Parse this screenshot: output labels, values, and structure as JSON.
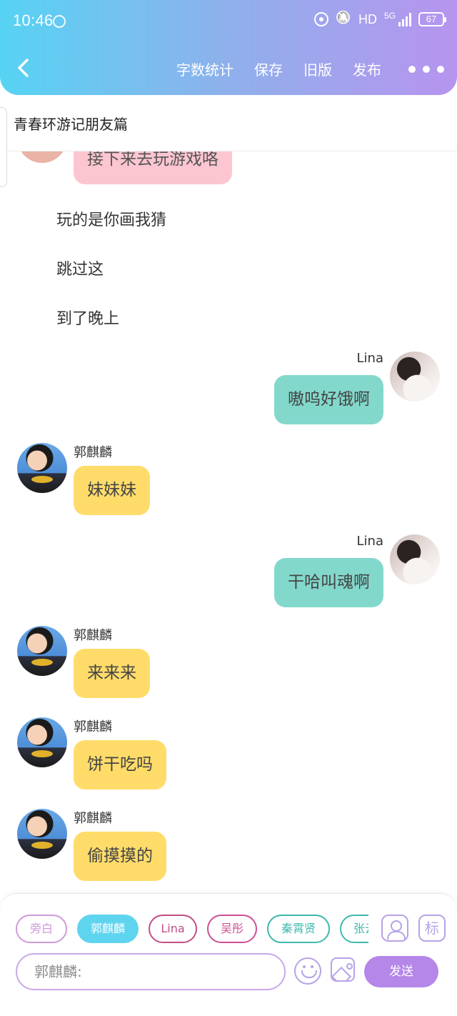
{
  "status_bar": {
    "time": "10:46",
    "network": "HD",
    "signal": "5G",
    "battery": "67"
  },
  "toolbar": {
    "word_count": "字数统计",
    "save": "保存",
    "old_version": "旧版",
    "publish": "发布"
  },
  "story": {
    "title": "青春环游记朋友篇"
  },
  "messages": [
    {
      "type": "bubble",
      "role": "top-partial",
      "text": "接下来去玩游戏咯"
    },
    {
      "type": "narration",
      "text": "玩的是你画我猜"
    },
    {
      "type": "narration",
      "text": "跳过这"
    },
    {
      "type": "narration",
      "text": "到了晚上"
    },
    {
      "type": "bubble",
      "sender": "Lina",
      "text": "嗷呜好饿啊"
    },
    {
      "type": "bubble",
      "sender": "郭麒麟",
      "text": "妹妹妹"
    },
    {
      "type": "bubble",
      "sender": "Lina",
      "text": "干哈叫魂啊"
    },
    {
      "type": "bubble",
      "sender": "郭麒麟",
      "text": "来来来"
    },
    {
      "type": "bubble",
      "sender": "郭麒麟",
      "text": "饼干吃吗"
    },
    {
      "type": "bubble",
      "sender": "郭麒麟",
      "text": "偷摸摸的"
    }
  ],
  "roles": [
    "旁白",
    "郭麒麟",
    "Lina",
    "吴彤",
    "秦霄贤",
    "张云"
  ],
  "composer": {
    "input_prefix": "郭麒麟:",
    "tag_label": "标",
    "send": "发送"
  },
  "colors": {
    "header_gradient": [
      "#56d3f3",
      "#b794ee"
    ],
    "bubble_guo": "#ffdc6a",
    "bubble_lina": "#83d8cc",
    "bubble_top": "#fcc6d0",
    "send_button": "#b587e8"
  }
}
